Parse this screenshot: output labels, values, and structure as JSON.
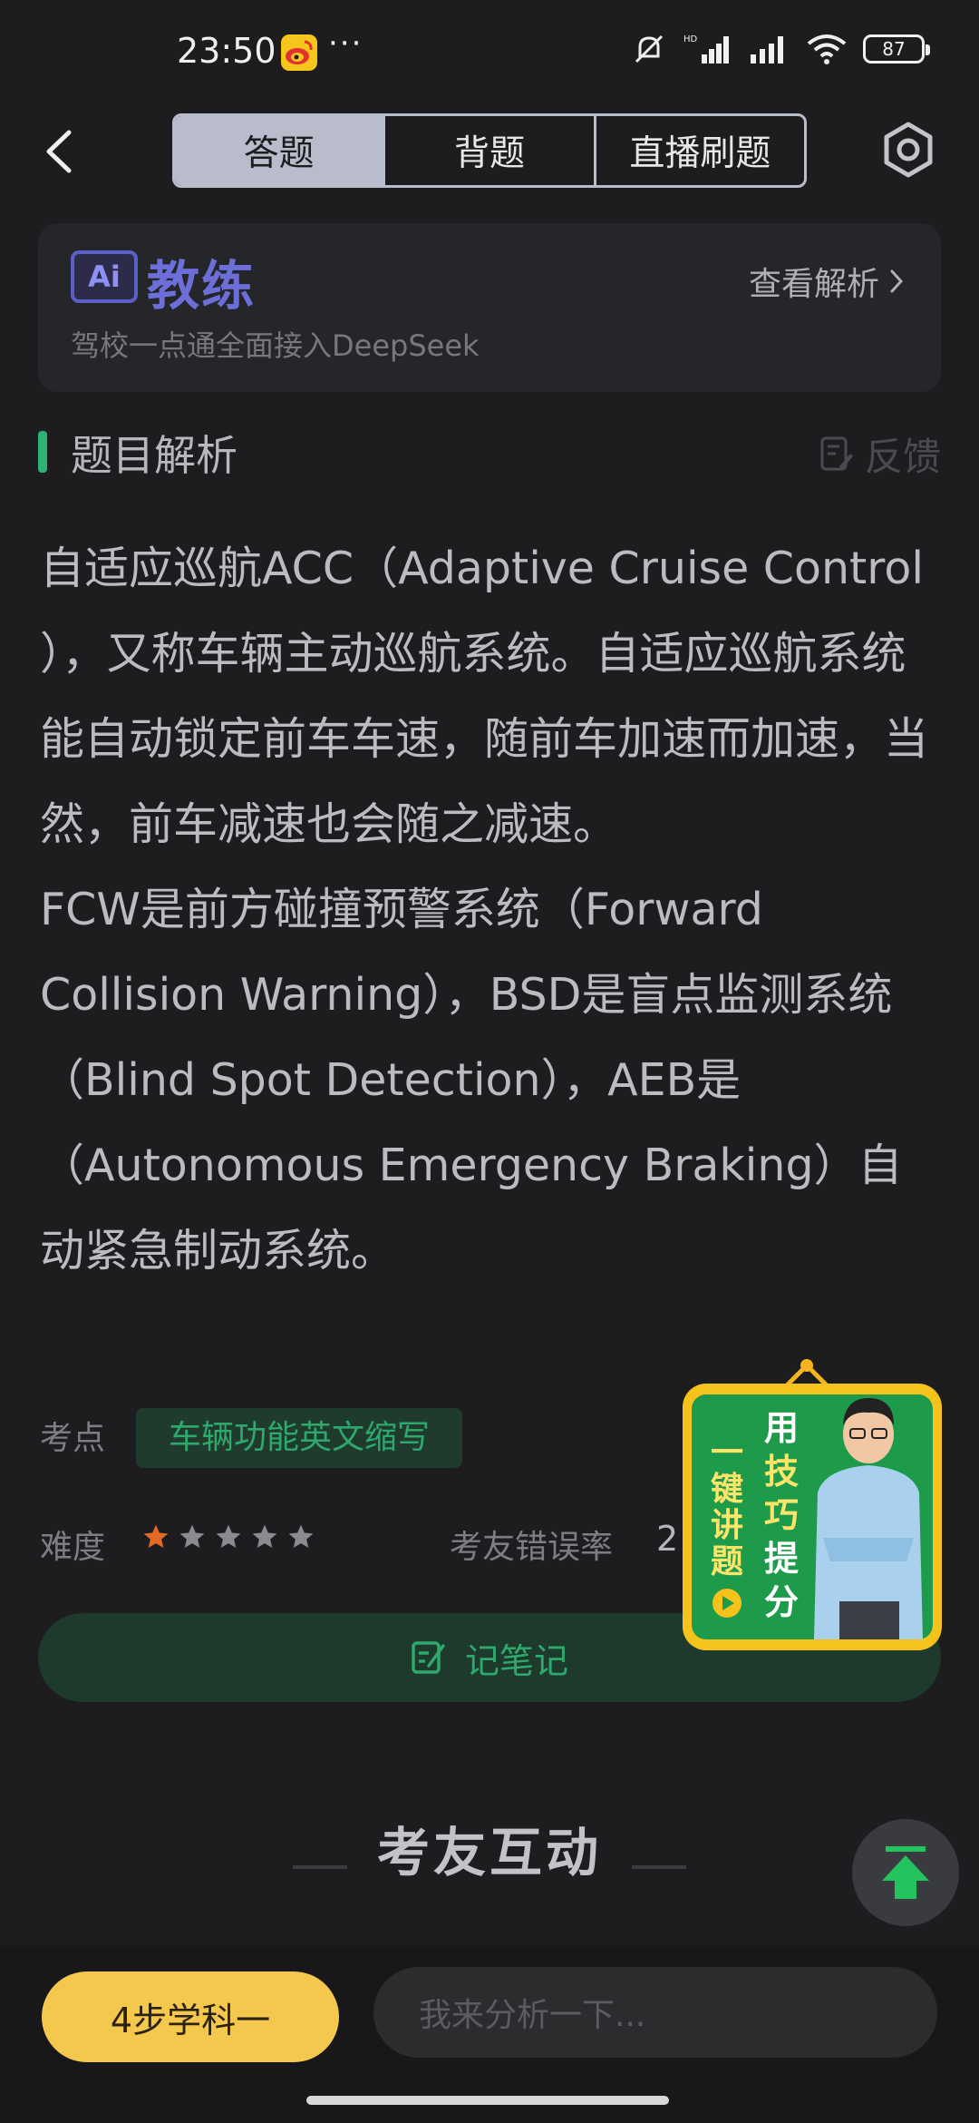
{
  "status_bar": {
    "time": "23:50",
    "dots": "···",
    "battery": "87"
  },
  "nav": {
    "tabs": [
      {
        "label": "答题",
        "active": true
      },
      {
        "label": "背题",
        "active": false
      },
      {
        "label": "直播刷题",
        "active": false
      }
    ]
  },
  "ai_card": {
    "logo": "Ai",
    "title": "教练",
    "subtitle": "驾校一点通全面接入DeepSeek",
    "link": "查看解析"
  },
  "section": {
    "title": "题目解析",
    "feedback": "反馈"
  },
  "explanation": "自适应巡航ACC（Adaptive Cruise Control ），又称车辆主动巡航系统。自适应巡航系统能自动锁定前车车速，随前车加速而加速，当然，前车减速也会随之减速。\nFCW是前方碰撞预警系统（Forward Collision Warning），BSD是盲点监测系统（Blind Spot Detection），AEB是（Autonomous Emergency Braking）自动紧急制动系统。",
  "meta": {
    "kp_label": "考点",
    "kp_tag": "车辆功能英文缩写",
    "difficulty_label": "难度",
    "difficulty_rating": 1,
    "difficulty_max": 5,
    "error_label": "考友错误率",
    "error_value": "2"
  },
  "note_button": "记笔记",
  "promo": {
    "left_text": "一键讲题",
    "right_text": "用技巧提分"
  },
  "interaction_title": "考友互动",
  "bottom": {
    "study_button": "4步学科一",
    "comment_placeholder": "我来分析一下..."
  },
  "colors": {
    "accent_green": "#2ea86c",
    "ai_purple": "#6c6fd8",
    "star_active": "#e36a26",
    "study_yellow": "#f4c84d"
  }
}
